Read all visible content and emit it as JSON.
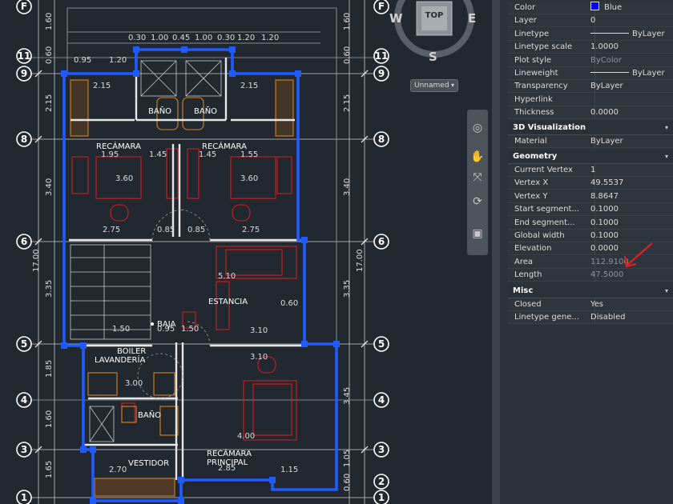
{
  "viewcube": {
    "top_label": "TOP",
    "north": "",
    "west": "W",
    "east": "E",
    "south": "S"
  },
  "named_view": {
    "label": "Unnamed",
    "chevron": "▾"
  },
  "navbar": {
    "icons": [
      "steering-wheel-icon",
      "pan-icon",
      "zoom-icon",
      "orbit-icon",
      "showmotion-icon"
    ]
  },
  "properties": {
    "general_rows": [
      {
        "key": "Color",
        "value": "Blue",
        "swatch": "#0000ff"
      },
      {
        "key": "Layer",
        "value": "0"
      },
      {
        "key": "Linetype",
        "value": "ByLayer",
        "line": true
      },
      {
        "key": "Linetype scale",
        "value": "1.0000"
      },
      {
        "key": "Plot style",
        "value": "ByColor",
        "disabled": true
      },
      {
        "key": "Lineweight",
        "value": "ByLayer",
        "line": true
      },
      {
        "key": "Transparency",
        "value": "ByLayer"
      },
      {
        "key": "Hyperlink",
        "value": ""
      },
      {
        "key": "Thickness",
        "value": "0.0000"
      }
    ],
    "sections": {
      "viz": {
        "title": "3D Visualization",
        "rows": [
          {
            "key": "Material",
            "value": "ByLayer"
          }
        ]
      },
      "geom": {
        "title": "Geometry",
        "rows": [
          {
            "key": "Current Vertex",
            "value": "1"
          },
          {
            "key": "Vertex X",
            "value": "49.5537"
          },
          {
            "key": "Vertex Y",
            "value": "8.8647"
          },
          {
            "key": "Start segment...",
            "value": "0.1000"
          },
          {
            "key": "End segment...",
            "value": "0.1000"
          },
          {
            "key": "Global width",
            "value": "0.1000"
          },
          {
            "key": "Elevation",
            "value": "0.0000"
          },
          {
            "key": "Area",
            "value": "112.9100",
            "disabled": true
          },
          {
            "key": "Length",
            "value": "47.5000",
            "disabled": true
          }
        ]
      },
      "misc": {
        "title": "Misc",
        "rows": [
          {
            "key": "Closed",
            "value": "Yes"
          },
          {
            "key": "Linetype gene...",
            "value": "Disabled"
          }
        ]
      }
    },
    "collapse_glyph": "▾"
  },
  "drawing": {
    "bubbles_left": [
      "F",
      "11",
      "9",
      "8",
      "6",
      "5",
      "4",
      "3",
      "1"
    ],
    "bubbles_right": [
      "F",
      "11",
      "9",
      "8",
      "6",
      "5",
      "4",
      "3",
      "2",
      "1"
    ],
    "rooms": {
      "bano1": "BAÑO",
      "bano2": "BAÑO",
      "recamara1": "RECÁMARA",
      "recamara2": "RECÁMARA",
      "estancia": "ESTANCIA",
      "baja": "BAJA",
      "boiler": "BOILER",
      "lavanderia": "LAVANDERÍA",
      "bano3": "BAÑO",
      "recamara_principal_1": "RECÁMARA",
      "recamara_principal_2": "PRINCIPAL",
      "vestidor": "VESTIDOR"
    },
    "dims_left": [
      "1.60",
      "0.60",
      "2.15",
      "3.40",
      "17.00",
      "3.35",
      "1.85",
      "1.60",
      "1.65"
    ],
    "dims_right": [
      "1.60",
      "0.60",
      "2.15",
      "3.40",
      "17.00",
      "3.35",
      "3.45",
      "1.05",
      "0.60"
    ],
    "top_dims": [
      "0.30",
      "1.00",
      "0.45",
      "1.00",
      "0.30",
      "1.20",
      "1.20"
    ],
    "interior_dims": {
      "a": "0.95",
      "b": "1.20",
      "c": "2.15",
      "d": "2.15",
      "e": "1.95",
      "f": "1.45",
      "g": "1.45",
      "h": "1.55",
      "i": "3.60",
      "j": "3.60",
      "k": "2.75",
      "l": "0.85",
      "m": "0.85",
      "n": "2.75",
      "o": "5.10",
      "p": "3.10",
      "q": "3.10",
      "r": "3.00",
      "s": "4.00",
      "t": "2.85",
      "u": "2.70",
      "v": "1.15",
      "w": "0.60",
      "x": "1.50",
      "y": "0.95",
      "z": "1.50"
    }
  }
}
